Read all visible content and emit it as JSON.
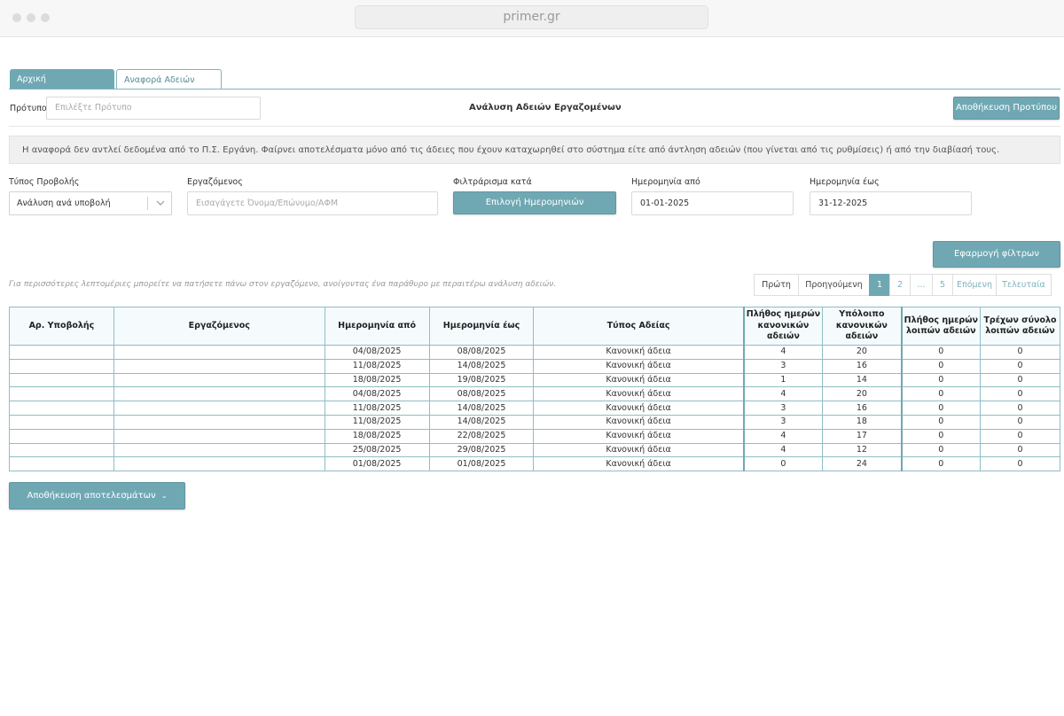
{
  "browser": {
    "url": "primer.gr"
  },
  "tabs": [
    {
      "label": "Αρχική"
    },
    {
      "label": "Αναφορά Αδειών"
    }
  ],
  "template": {
    "label": "Πρότυπο",
    "placeholder": "Επιλέξτε Πρότυπο",
    "save_button": "Αποθήκευση Προτύπου"
  },
  "page_title": "Ανάλυση Αδειών Εργαζομένων",
  "notice": "Η αναφορά δεν αντλεί δεδομένα από το Π.Σ. Εργάνη. Φαίρνει αποτελέσματα μόνο από τις άδειες που έχουν καταχωρηθεί στο σύστημα είτε από άντληση αδειών (που γίνεται από τις ρυθμίσεις) ή από την διαβίασή τους.",
  "filters": {
    "view_type_label": "Τύπος Προβολής",
    "view_type_value": "Ανάλυση ανά υποβολή",
    "employee_label": "Εργαζόμενος",
    "employee_placeholder": "Εισαγάγετε Όνομα/Επώνυμο/ΑΦΜ",
    "filter_by_label": "Φιλτράρισμα κατά",
    "filter_by_button": "Επιλογή Ημερομηνιών",
    "date_from_label": "Ημερομηνία από",
    "date_from_value": "01-01-2025",
    "date_to_label": "Ημερομηνία έως",
    "date_to_value": "31-12-2025",
    "apply_button": "Εφαρμογή φίλτρων"
  },
  "hint": "Για περισσότερες λεπτομέριες μπορείτε να πατήσετε πάνω στον εργαζόμενο, ανοίγοντας ένα παράθυρο με περαιτέρω ανάλυση αδειών.",
  "pagination": {
    "first": "Πρώτη",
    "prev": "Προηγούμενη",
    "pages": [
      "1",
      "2",
      "...",
      "5"
    ],
    "next": "Επόμενη",
    "last": "Τελευταία"
  },
  "table": {
    "headers": [
      "Αρ. Υποβολής",
      "Εργαζόμενος",
      "Ημερομηνία από",
      "Ημερομηνία έως",
      "Τύπος Αδείας",
      "Πλήθος ημερών κανονικών αδειών",
      "Υπόλοιπο κανονικών αδειών",
      "Πλήθος ημερών λοιπών αδειών",
      "Τρέχων σύνολο λοιπών αδειών"
    ],
    "rows": [
      [
        "",
        "",
        "04/08/2025",
        "08/08/2025",
        "Κανονική άδεια",
        "4",
        "20",
        "0",
        "0"
      ],
      [
        "",
        "",
        "11/08/2025",
        "14/08/2025",
        "Κανονική άδεια",
        "3",
        "16",
        "0",
        "0"
      ],
      [
        "",
        "",
        "18/08/2025",
        "19/08/2025",
        "Κανονική άδεια",
        "1",
        "14",
        "0",
        "0"
      ],
      [
        "",
        "",
        "04/08/2025",
        "08/08/2025",
        "Κανονική άδεια",
        "4",
        "20",
        "0",
        "0"
      ],
      [
        "",
        "",
        "11/08/2025",
        "14/08/2025",
        "Κανονική άδεια",
        "3",
        "16",
        "0",
        "0"
      ],
      [
        "",
        "",
        "11/08/2025",
        "14/08/2025",
        "Κανονική άδεια",
        "3",
        "18",
        "0",
        "0"
      ],
      [
        "",
        "",
        "18/08/2025",
        "22/08/2025",
        "Κανονική άδεια",
        "4",
        "17",
        "0",
        "0"
      ],
      [
        "",
        "",
        "25/08/2025",
        "29/08/2025",
        "Κανονική άδεια",
        "4",
        "12",
        "0",
        "0"
      ],
      [
        "",
        "",
        "01/08/2025",
        "01/08/2025",
        "Κανονική άδεια",
        "0",
        "24",
        "0",
        "0"
      ]
    ]
  },
  "export_button": "Αποθήκευση αποτελεσμάτων",
  "colors": {
    "accent": "#6fa8b3",
    "table_border": "#8fbdc6"
  }
}
